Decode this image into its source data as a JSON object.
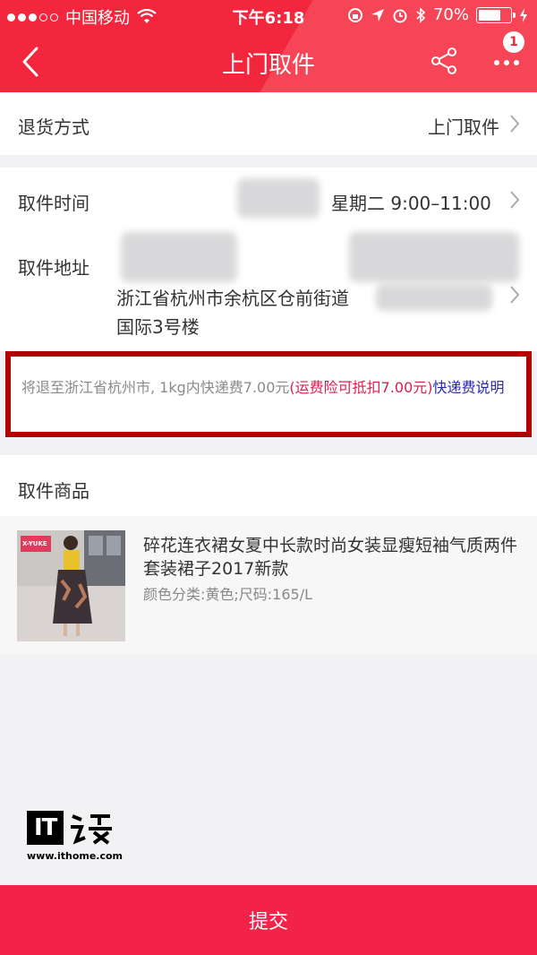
{
  "status_bar": {
    "carrier": "中国移动",
    "time": "下午6:18",
    "battery": "70%"
  },
  "nav": {
    "title": "上门取件",
    "badge_count": "1"
  },
  "return_method": {
    "label": "退货方式",
    "value": "上门取件"
  },
  "pickup_time": {
    "label": "取件时间",
    "value": "星期二 9:00–11:00"
  },
  "pickup_address": {
    "label": "取件地址",
    "line1": "浙江省杭州市余杭区仓前街道",
    "line2": "国际3号楼"
  },
  "notice": {
    "text": "将退至浙江省杭州市, 1kg内快递费7.00元",
    "insurance": "(运费险可抵扣7.00元)",
    "link": "快递费说明"
  },
  "goods_section": {
    "label": "取件商品"
  },
  "product": {
    "title": "碎花连衣裙女夏中长款时尚女装显瘦短袖气质两件套装裙子2017新款",
    "spec": "颜色分类:黄色;尺码:165/L",
    "thumb_brand": "X-YUKE"
  },
  "submit": {
    "label": "提交"
  },
  "watermark": {
    "brand": "IT",
    "url": "www.ithome.com"
  }
}
